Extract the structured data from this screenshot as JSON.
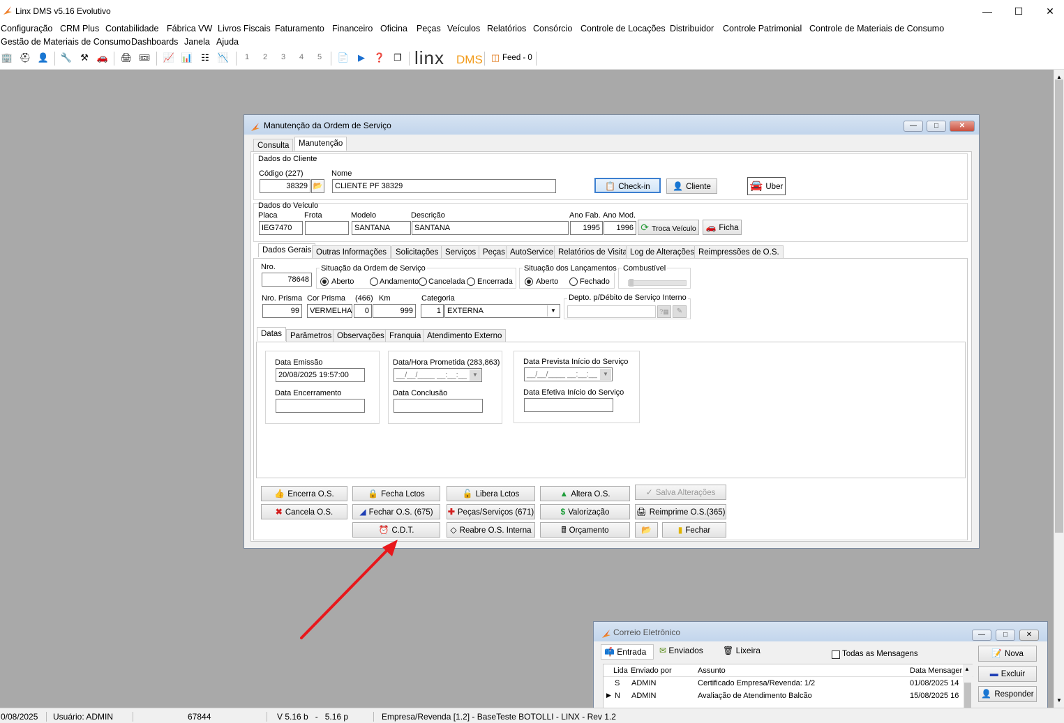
{
  "app": {
    "title": "Linx DMS v5.16 Evolutivo"
  },
  "menu": [
    "Configuração",
    "CRM Plus",
    "Contabilidade",
    "Fábrica VW",
    "Livros Fiscais",
    "Faturamento",
    "Financeiro",
    "Oficina",
    "Peças",
    "Veículos",
    "Relatórios",
    "Consórcio",
    "Controle de Locações",
    "Distribuidor",
    "Controle Patrimonial",
    "Controle de Materiais de Consumo",
    "Gestão de Materiais de Consumo",
    "Dashboards",
    "Janela",
    "Ajuda"
  ],
  "toolbar": {
    "numbers": [
      "1",
      "2",
      "3",
      "4",
      "5"
    ],
    "brand_linx": "linx",
    "brand_dms": "DMS",
    "feed": "Feed - 0"
  },
  "os_window": {
    "title": "Manutenção da Ordem de Serviço",
    "tabs": [
      "Consulta",
      "Manutenção"
    ],
    "cliente": {
      "section": "Dados do Cliente",
      "codigo_label": "Código (227)",
      "codigo": "38329",
      "nome_label": "Nome",
      "nome": "CLIENTE PF 38329",
      "checkin": "Check-in",
      "cliente_btn": "Cliente",
      "uber": "Uber"
    },
    "veiculo": {
      "section": "Dados do Veículo",
      "placa_label": "Placa",
      "placa": "IEG7470",
      "frota_label": "Frota",
      "frota": "",
      "modelo_label": "Modelo",
      "modelo": "SANTANA",
      "descricao_label": "Descrição",
      "descricao": "SANTANA",
      "anofab_label": "Ano Fab.",
      "anofab": "1995",
      "anomod_label": "Ano Mod.",
      "anomod": "1996",
      "troca": "Troca Veículo",
      "ficha": "Ficha"
    },
    "subtabs": [
      "Dados Gerais",
      "Outras Informações",
      "Solicitações",
      "Serviços",
      "Peças",
      "AutoService",
      "Relatórios de Visita",
      "Log de Alterações",
      "Reimpressões de O.S."
    ],
    "geral": {
      "nro_label": "Nro.",
      "nro": "78648",
      "situacao_label": "Situação da Ordem de Serviço",
      "situacao_opts": [
        "Aberto",
        "Andamento",
        "Cancelada",
        "Encerrada"
      ],
      "lanc_label": "Situação dos Lançamentos",
      "lanc_opts": [
        "Aberto",
        "Fechado"
      ],
      "combustivel_label": "Combustível",
      "prisma_label": "Nro. Prisma",
      "prisma": "99",
      "cor_label": "Cor Prisma",
      "cor": "VERMELHA",
      "cod466_label": "(466)",
      "cod466": "0",
      "km_label": "Km",
      "km": "999",
      "categoria_label": "Categoria",
      "categoria_num": "1",
      "categoria": "EXTERNA",
      "depto_label": "Depto. p/Débito de Serviço Interno"
    },
    "datetabs": [
      "Datas",
      "Parâmetros",
      "Observações",
      "Franquia",
      "Atendimento Externo"
    ],
    "datas": {
      "emissao_label": "Data Emissão",
      "emissao": "20/08/2025 19:57:00",
      "encerramento_label": "Data Encerramento",
      "prometida_label": "Data/Hora Prometida (283,863)",
      "prometida_mask": "__/__/____ __:__:__",
      "conclusao_label": "Data Conclusão",
      "prevista_label": "Data Prevista Início do Serviço",
      "prevista_mask": "__/__/____ __:__:__",
      "efetiva_label": "Data Efetiva Início do Serviço"
    },
    "actions": {
      "encerra": "Encerra O.S.",
      "fecha_lctos": "Fecha Lctos",
      "libera": "Libera Lctos",
      "altera": "Altera O.S.",
      "salva": "Salva Alterações",
      "cancela": "Cancela O.S.",
      "fechar_os": "Fechar O.S. (675)",
      "pecas": "Peças/Serviços (671)",
      "valorizacao": "Valorização",
      "reimprime": "Reimprime O.S.(365)",
      "cdt": "C.D.T.",
      "reabre": "Reabre O.S. Interna",
      "orcamento": "Orçamento",
      "fechar": "Fechar"
    }
  },
  "mail_window": {
    "title": "Correio Eletrônico",
    "tabs": [
      "Entrada",
      "Enviados",
      "Lixeira"
    ],
    "todas": "Todas as Mensagens",
    "columns": [
      "Lida",
      "Enviado por",
      "Assunto",
      "Data Mensager"
    ],
    "rows": [
      {
        "lida": "S",
        "por": "ADMIN",
        "assunto": "Certificado Empresa/Revenda: 1/2",
        "data": "01/08/2025 14"
      },
      {
        "lida": "N",
        "por": "ADMIN",
        "assunto": "Avaliação de Atendimento Balcão",
        "data": "15/08/2025 16"
      }
    ],
    "buttons": [
      "Nova",
      "Excluir",
      "Responder"
    ]
  },
  "status": {
    "date": "0/08/2025",
    "user": "Usuário: ADMIN",
    "code": "67844",
    "version": "V 5.16 b   -   5.16 p",
    "empresa": "Empresa/Revenda [1.2] - BaseTeste BOTOLLI - LINX - Rev 1.2"
  },
  "colors": {
    "accent_red": "#e8171b",
    "titlebar": "#c9d9ee"
  }
}
